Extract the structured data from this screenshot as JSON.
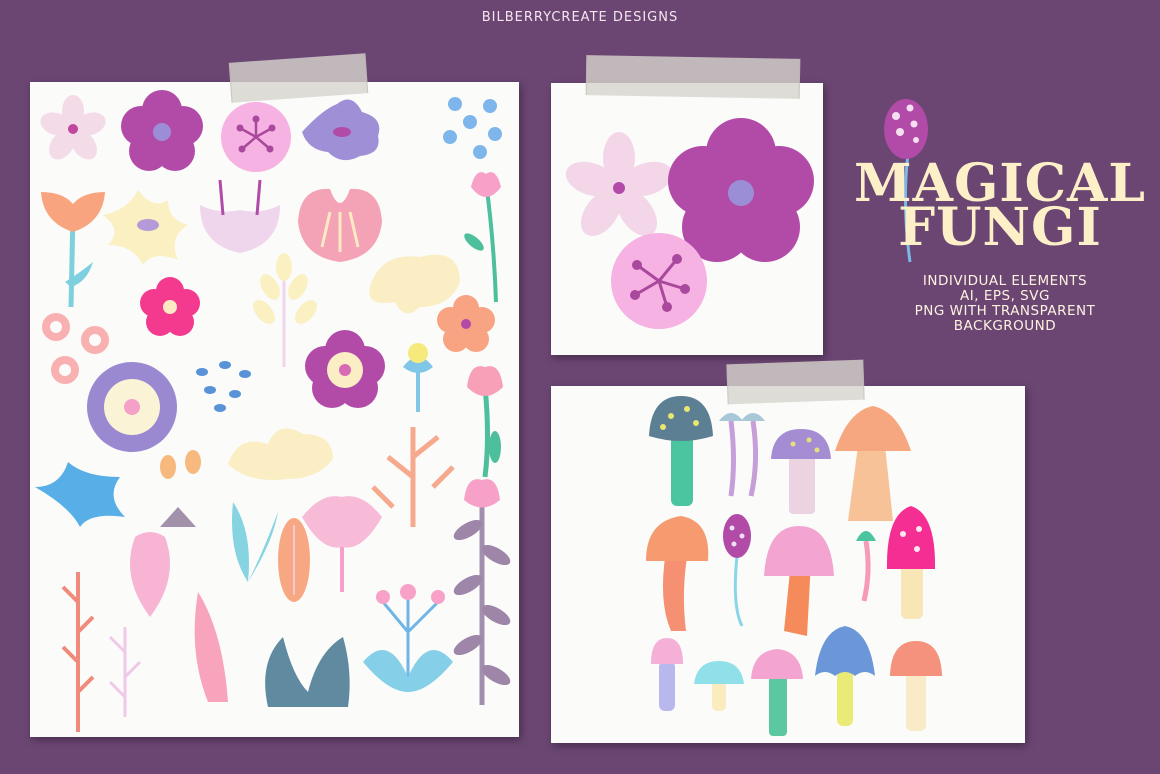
{
  "brand": "BILBERRYCREATE DESIGNS",
  "title": {
    "line1": "MAGICAL",
    "line2": "FUNGI"
  },
  "subtitle": {
    "line1": "INDIVIDUAL ELEMENTS",
    "line2": "AI, EPS, SVG",
    "line3": "PNG WITH TRANSPARENT",
    "line4": "BACKGROUND"
  },
  "colors": {
    "background": "#6b4673",
    "paper": "#fbfbfa",
    "title": "#fdf0c8",
    "magenta": "#b24aa8",
    "pink": "#f4a9dc",
    "lavender": "#a692d0",
    "peach": "#f7a886",
    "blue": "#6fb5e6"
  }
}
